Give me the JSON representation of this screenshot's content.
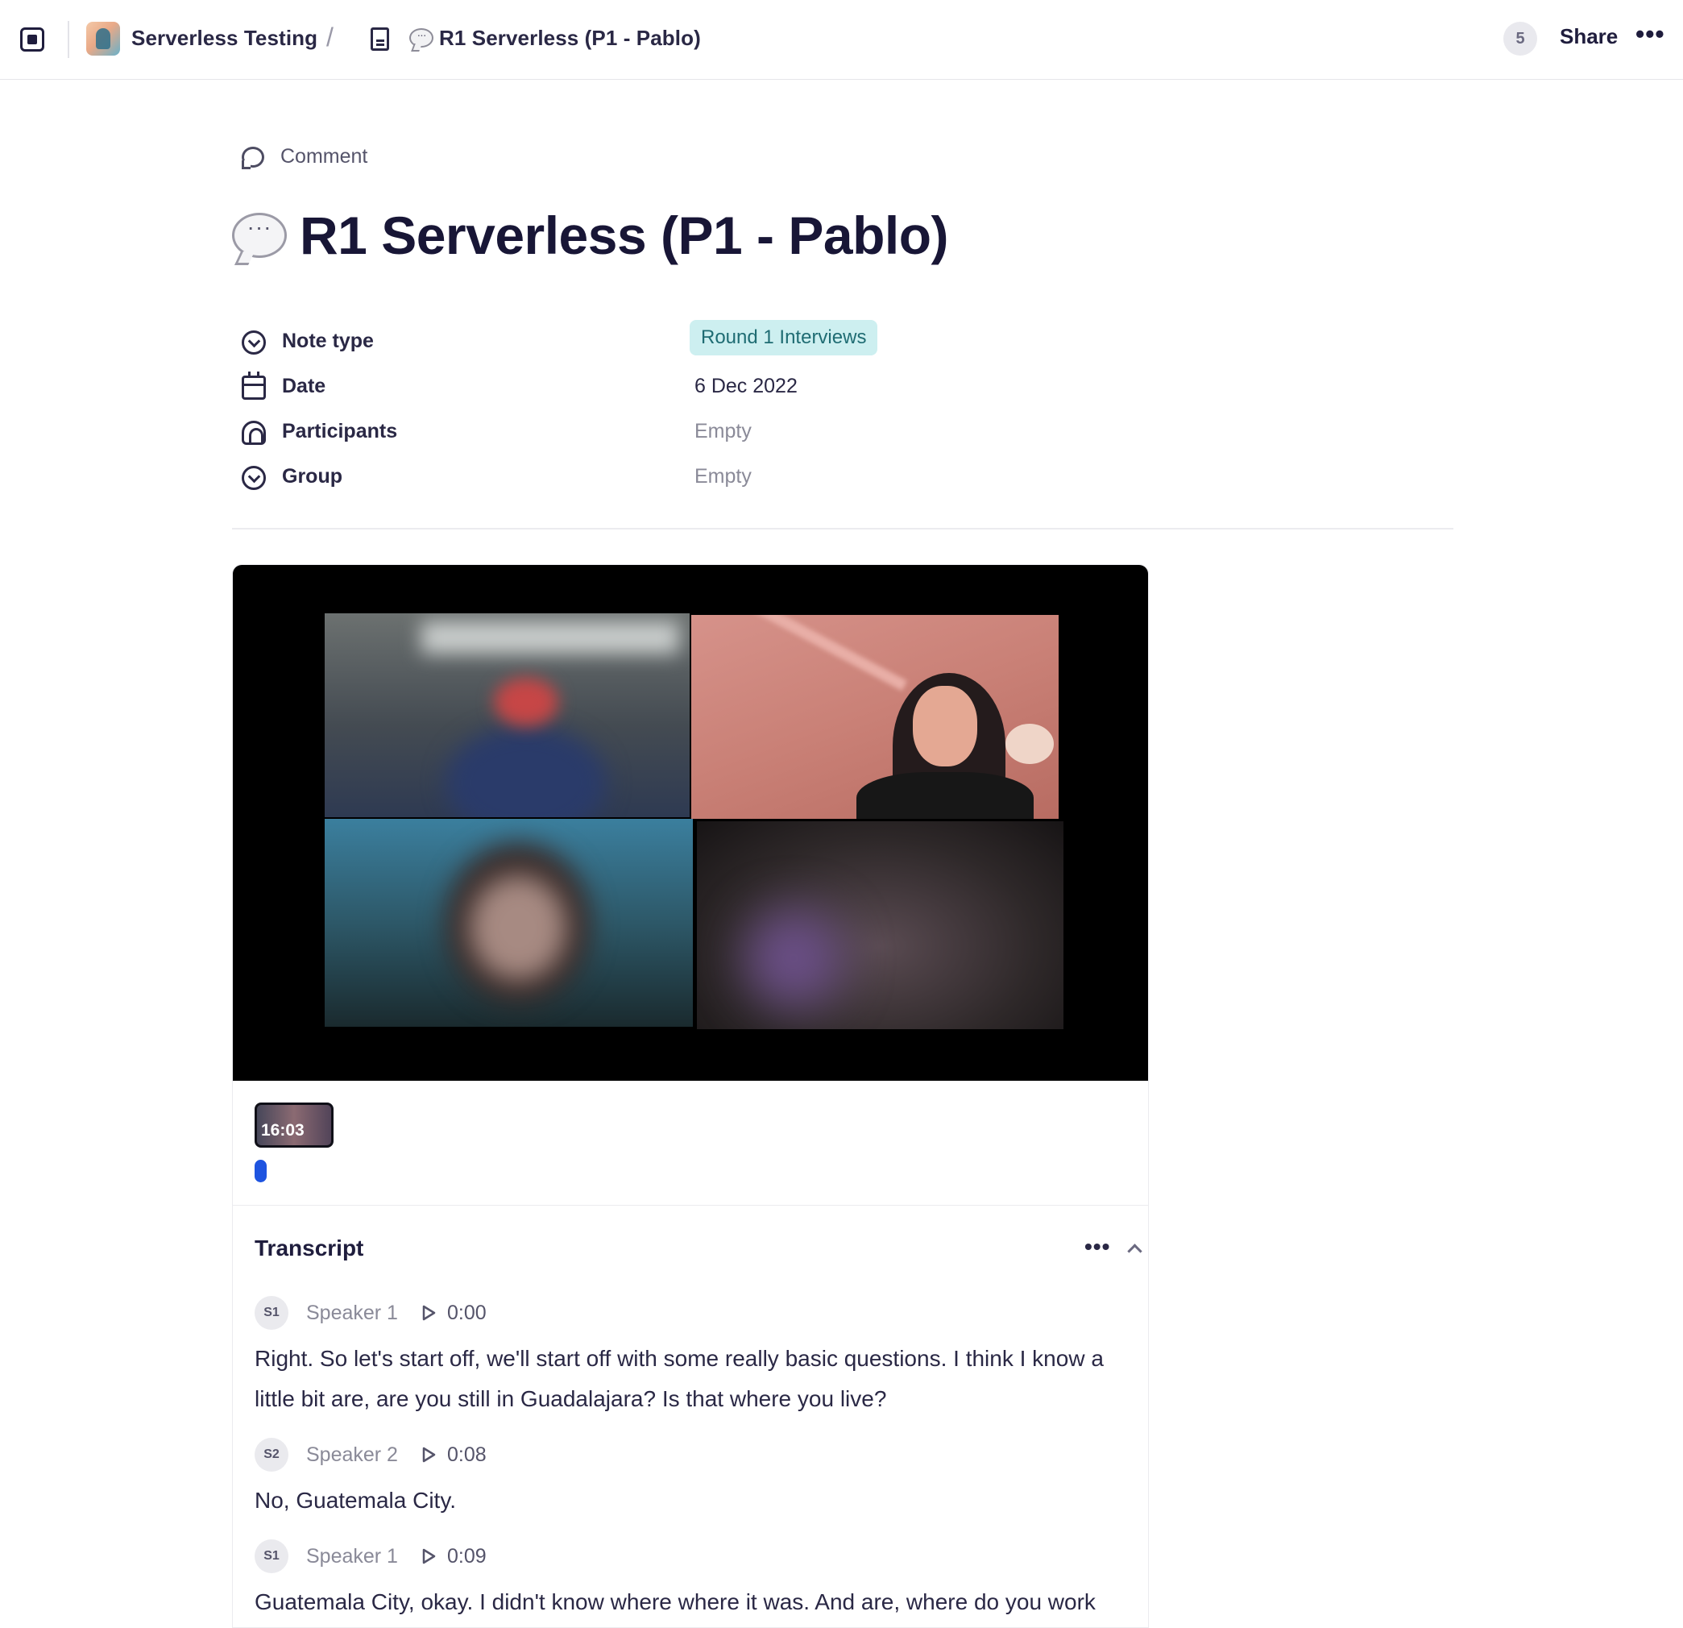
{
  "topbar": {
    "workspace": "Serverless Testing",
    "separator": "/",
    "page": "R1 Serverless (P1 - Pablo)",
    "count": "5",
    "share_label": "Share",
    "more": "•••"
  },
  "comment_label": "Comment",
  "page_title": "R1 Serverless (P1 - Pablo)",
  "properties": {
    "note_type": {
      "label": "Note type",
      "value": "Round 1 Interviews",
      "icon": "circle-chevron-icon"
    },
    "date": {
      "label": "Date",
      "value": "6 Dec 2022",
      "icon": "calendar-icon"
    },
    "participants": {
      "label": "Participants",
      "value": "Empty",
      "icon": "fingerprint-icon"
    },
    "group": {
      "label": "Group",
      "value": "Empty",
      "icon": "circle-chevron-icon"
    }
  },
  "video": {
    "thumbnail_duration": "16:03",
    "progress": 0
  },
  "transcript": {
    "title": "Transcript",
    "more": "•••",
    "utterances": [
      {
        "badge": "S1",
        "speaker": "Speaker 1",
        "time": "0:00",
        "text": "Right. So let's start off, we'll start off with some really basic questions. I think I know a little bit are, are you still in Guadalajara? Is that where you live?"
      },
      {
        "badge": "S2",
        "speaker": "Speaker 2",
        "time": "0:08",
        "text": "No, Guatemala City."
      },
      {
        "badge": "S1",
        "speaker": "Speaker 1",
        "time": "0:09",
        "text": "Guatemala City, okay. I didn't know where where it was. And are, where do you work"
      }
    ]
  }
}
